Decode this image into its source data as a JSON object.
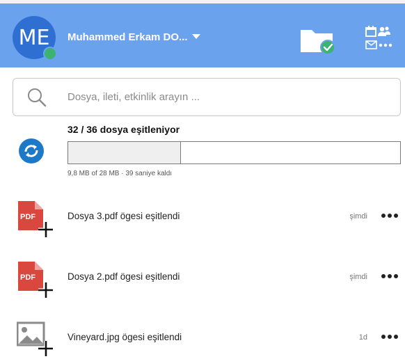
{
  "header": {
    "avatar_initials": "ME",
    "user_name": "Muhammed Erkam DO...",
    "folder_icon": "folder-check-icon",
    "calendar_icon": "calendar-contacts-mail-icon",
    "colors": {
      "background": "#6aa2ee",
      "avatar": "#2e6fd1",
      "presence": "#3cb371"
    }
  },
  "search": {
    "placeholder": "Dosya, ileti, etkinlik arayın ...",
    "value": ""
  },
  "sync": {
    "title": "32 / 36 dosya eşitleniyor",
    "progress": 0.34,
    "detail": "9,8 MB of 28 MB · 39 saniye kaldı",
    "icon": "sync-icon",
    "color": "#1e78c8"
  },
  "activity": [
    {
      "icon": "pdf-add-icon",
      "text": "Dosya 3.pdf ögesi eşitlendi",
      "time": "şimdi"
    },
    {
      "icon": "pdf-add-icon",
      "text": "Dosya 2.pdf ögesi eşitlendi",
      "time": "şimdi"
    },
    {
      "icon": "image-add-icon",
      "text": "Vineyard.jpg ögesi eşitlendi",
      "time": "1d"
    }
  ]
}
